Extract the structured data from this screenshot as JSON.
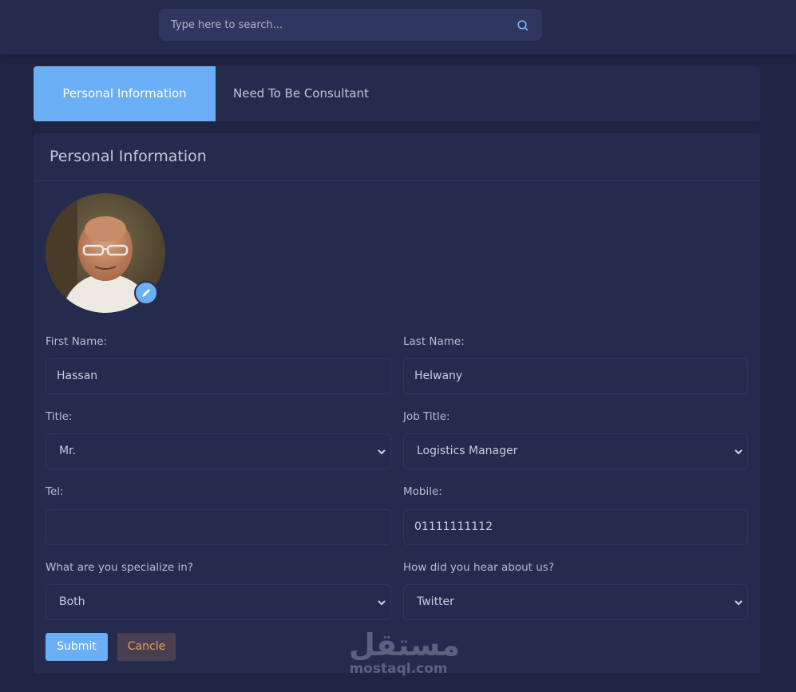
{
  "search": {
    "placeholder": "Type here to search..."
  },
  "tabs": [
    {
      "label": "Personal Information",
      "active": true
    },
    {
      "label": "Need To Be Consultant",
      "active": false
    }
  ],
  "card": {
    "title": "Personal Information"
  },
  "form": {
    "first_name": {
      "label": "First Name:",
      "value": "Hassan"
    },
    "last_name": {
      "label": "Last Name:",
      "value": "Helwany"
    },
    "title": {
      "label": "Title:",
      "value": "Mr."
    },
    "job_title": {
      "label": "Job Title:",
      "value": "Logistics Manager"
    },
    "tel": {
      "label": "Tel:",
      "value": ""
    },
    "mobile": {
      "label": "Mobile:",
      "value": "01111111112"
    },
    "specialize": {
      "label": "What are you specialize in?",
      "value": "Both"
    },
    "heard": {
      "label": "How did you hear about us?",
      "value": "Twitter"
    }
  },
  "buttons": {
    "submit": "Submit",
    "cancel": "Cancle"
  },
  "watermark": {
    "arabic": "مستقل",
    "latin": "mostaql.com"
  },
  "colors": {
    "accent": "#6aaef6",
    "background": "#1e2442",
    "panel": "#252b4c",
    "cancel_text": "#e0a55c"
  },
  "icons": {
    "search": "search-icon",
    "edit": "pencil-icon",
    "dropdown": "chevron-down-icon"
  }
}
